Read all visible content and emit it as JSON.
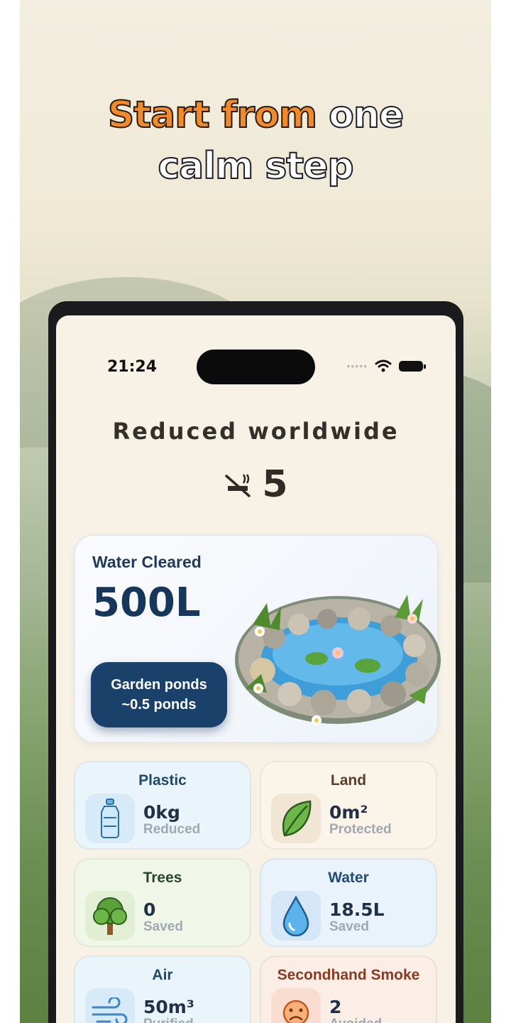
{
  "headline": {
    "accent": "Start from",
    "rest_line1": "one",
    "line2": "calm step"
  },
  "status_bar": {
    "time": "21:24"
  },
  "summary": {
    "title": "Reduced worldwide",
    "count": "5"
  },
  "water_card": {
    "label": "Water Cleared",
    "value": "500L",
    "button_line1": "Garden ponds",
    "button_line2": "~0.5 ponds"
  },
  "tiles": [
    {
      "title": "Plastic",
      "value": "0kg",
      "sub": "Reduced",
      "icon": "water-bottle-icon",
      "title_color": "#1f4a66",
      "bg": "#eaf5fb",
      "icon_bg": "#d6ebf7"
    },
    {
      "title": "Land",
      "value": "0m²",
      "sub": "Protected",
      "icon": "leaf-icon",
      "title_color": "#5a3e2a",
      "bg": "#fbf4e9",
      "icon_bg": "#f1e6d4"
    },
    {
      "title": "Trees",
      "value": "0",
      "sub": "Saved",
      "icon": "tree-icon",
      "title_color": "#27462d",
      "bg": "#f1f7e8",
      "icon_bg": "#e2efd5"
    },
    {
      "title": "Water",
      "value": "18.5L",
      "sub": "Saved",
      "icon": "water-drop-icon",
      "title_color": "#1f4a7a",
      "bg": "#eaf3fb",
      "icon_bg": "#d5e7f6"
    },
    {
      "title": "Air",
      "value": "50m³",
      "sub": "Purified",
      "icon": "wind-icon",
      "title_color": "#1f4a66",
      "bg": "#eaf5fb",
      "icon_bg": "#d6ebf7"
    },
    {
      "title": "Secondhand Smoke",
      "value": "2",
      "sub": "Avoided",
      "icon": "sad-face-icon",
      "title_color": "#8a3a22",
      "bg": "#fbeee7",
      "icon_bg": "#f8ddd0"
    }
  ]
}
